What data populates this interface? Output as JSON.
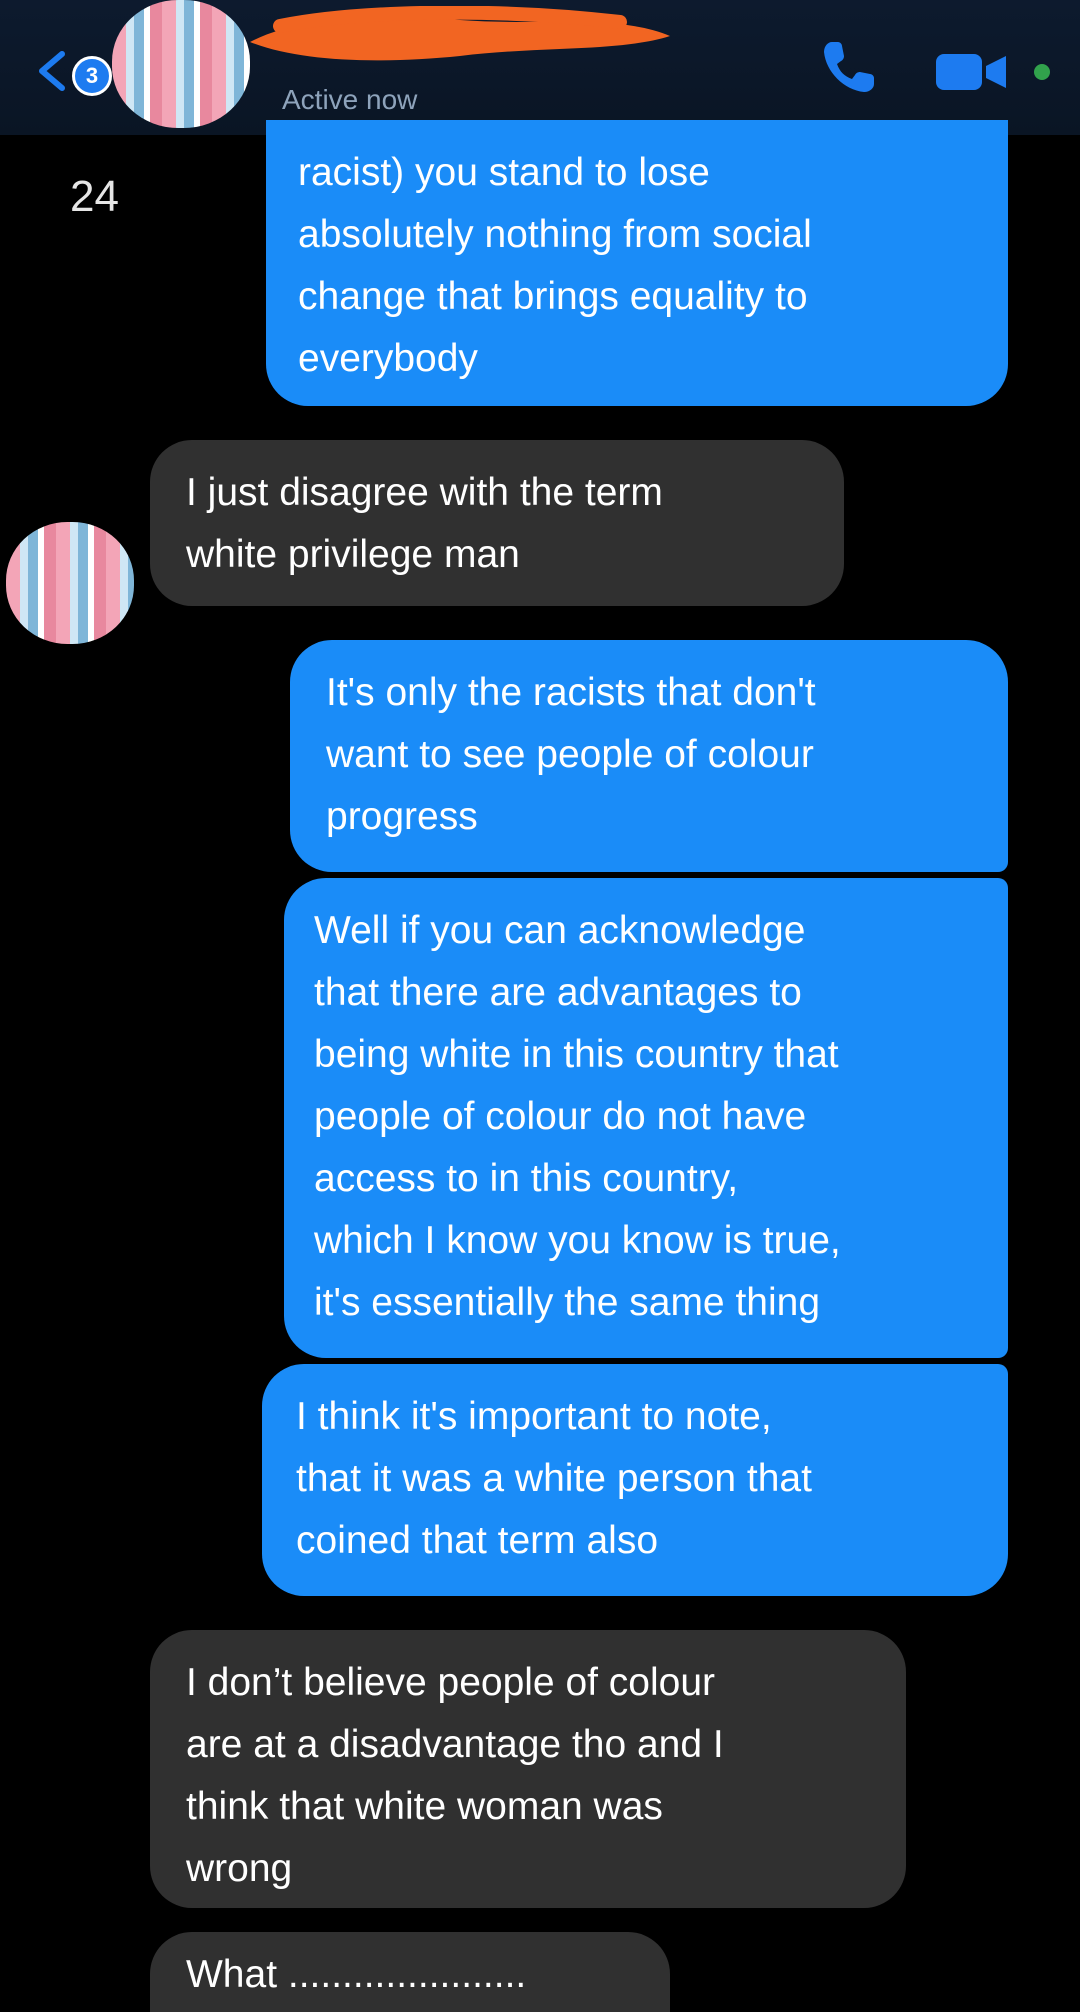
{
  "header": {
    "back_badge_count": "3",
    "status": "Active now",
    "online_color": "#31a24c",
    "icons": [
      "back-chevron-icon",
      "phone-icon",
      "video-camera-icon"
    ]
  },
  "side_label": "24",
  "colors": {
    "outgoing_bubble": "#1a8cf8",
    "incoming_bubble": "#303030",
    "background": "#000000"
  },
  "messages": [
    {
      "direction": "outgoing",
      "text": "racist) you stand to lose\nabsolutely nothing from social\nchange that brings equality to\neverybody"
    },
    {
      "direction": "incoming",
      "text": "I just disagree with the term\nwhite privilege man"
    },
    {
      "direction": "outgoing",
      "text": "It's only the racists that don't\nwant to see people of colour\nprogress"
    },
    {
      "direction": "outgoing",
      "text": "Well if you can acknowledge\nthat there are advantages to\nbeing white in this country that\npeople of colour do not have\naccess to in this country,\nwhich I know you know is true,\nit's essentially the same thing"
    },
    {
      "direction": "outgoing",
      "text": "I think it's important to note,\nthat it was a white person that\ncoined that term also"
    },
    {
      "direction": "incoming",
      "text": "I don’t believe people of colour\nare at a disadvantage tho and I\nthink that white woman was\nwrong"
    },
    {
      "direction": "incoming",
      "text": "What ...................... "
    }
  ]
}
